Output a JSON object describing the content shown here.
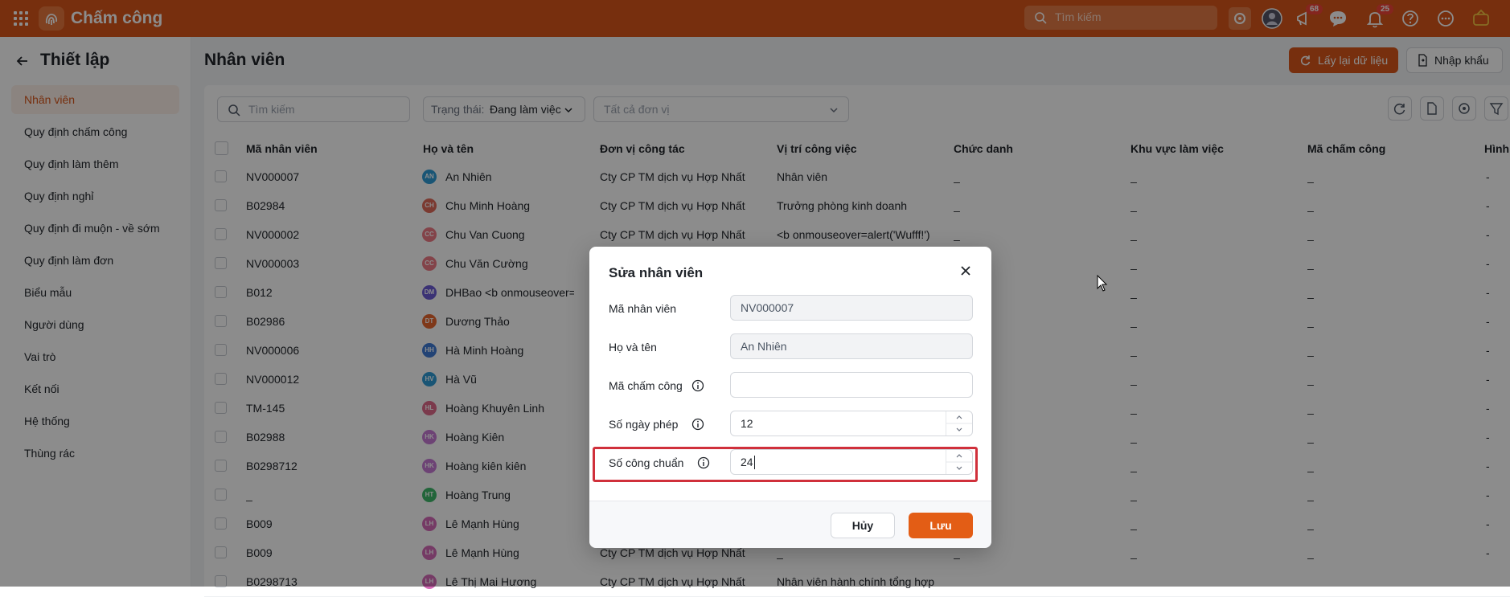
{
  "app": {
    "title": "Chấm công"
  },
  "topbar": {
    "search_placeholder": "Tìm kiếm",
    "announcement_badge": "68",
    "notification_badge": "25"
  },
  "sidebar": {
    "title": "Thiết lập",
    "items": [
      {
        "label": "Nhân viên",
        "active": true
      },
      {
        "label": "Quy định chấm công"
      },
      {
        "label": "Quy định làm thêm"
      },
      {
        "label": "Quy định nghỉ"
      },
      {
        "label": "Quy định đi muộn - về sớm"
      },
      {
        "label": "Quy định làm đơn"
      },
      {
        "label": "Biểu mẫu"
      },
      {
        "label": "Người dùng"
      },
      {
        "label": "Vai trò"
      },
      {
        "label": "Kết nối"
      },
      {
        "label": "Hệ thống"
      },
      {
        "label": "Thùng rác"
      }
    ]
  },
  "page": {
    "title": "Nhân viên",
    "reload_button": "Lấy lại dữ liệu",
    "import_button": "Nhập khẩu"
  },
  "filters": {
    "search_placeholder": "Tìm kiếm",
    "status_label": "Trạng thái:",
    "status_value": "Đang làm việc",
    "unit_placeholder": "Tất cả đơn vị"
  },
  "table": {
    "columns": [
      "Mã nhân viên",
      "Họ và tên",
      "Đơn vị công tác",
      "Vị trí công việc",
      "Chức danh",
      "Khu vực làm việc",
      "Mã chấm công",
      "Hình"
    ],
    "rows": [
      {
        "code": "NV000007",
        "initials": "AN",
        "color": "#2f9bd6",
        "name": "An Nhiên",
        "unit": "Cty CP TM dịch vụ Hợp Nhất",
        "position": "Nhân viên",
        "title": "_",
        "area": "_",
        "att": "_",
        "img": "-"
      },
      {
        "code": "B02984",
        "initials": "CH",
        "color": "#e06a5a",
        "name": "Chu Minh Hoàng",
        "unit": "Cty CP TM dịch vụ Hợp Nhất",
        "position": "Trưởng phòng kinh doanh",
        "title": "_",
        "area": "_",
        "att": "_",
        "img": "-"
      },
      {
        "code": "NV000002",
        "initials": "CC",
        "color": "#ef7b86",
        "name": "Chu Van Cuong",
        "unit": "Cty CP TM dịch vụ Hợp Nhất",
        "position": "<b onmouseover=alert('Wufff!')",
        "title": "_",
        "area": "_",
        "att": "_",
        "img": "-"
      },
      {
        "code": "NV000003",
        "initials": "CC",
        "color": "#ef7b86",
        "name": "Chu Văn Cường",
        "unit": "",
        "position": "",
        "title": "",
        "area": "_",
        "att": "_",
        "img": "-"
      },
      {
        "code": "B012",
        "initials": "DM",
        "color": "#6c5bd6",
        "name": "DHBao <b onmouseover=alert",
        "unit": "",
        "position": "",
        "title": "",
        "area": "_",
        "att": "_",
        "img": "-"
      },
      {
        "code": "B02986",
        "initials": "DT",
        "color": "#e8662f",
        "name": "Dương Thảo",
        "unit": "",
        "position": "",
        "title": "",
        "area": "_",
        "att": "_",
        "img": "-"
      },
      {
        "code": "NV000006",
        "initials": "HH",
        "color": "#3e7ad6",
        "name": "Hà Minh Hoàng",
        "unit": "",
        "position": "",
        "title": "",
        "area": "_",
        "att": "_",
        "img": "-"
      },
      {
        "code": "NV000012",
        "initials": "HV",
        "color": "#2f9bd6",
        "name": "Hà Vũ",
        "unit": "",
        "position": "",
        "title": "",
        "area": "_",
        "att": "_",
        "img": "-"
      },
      {
        "code": "TM-145",
        "initials": "HL",
        "color": "#e06a8a",
        "name": "Hoàng Khuyên Linh",
        "unit": "",
        "position": "",
        "title": "",
        "area": "_",
        "att": "_",
        "img": "-"
      },
      {
        "code": "B02988",
        "initials": "HK",
        "color": "#c77bd6",
        "name": "Hoàng Kiên",
        "unit": "",
        "position": "",
        "title": "",
        "area": "_",
        "att": "_",
        "img": "-"
      },
      {
        "code": "B0298712",
        "initials": "HK",
        "color": "#c77bd6",
        "name": "Hoàng kiên kiên",
        "unit": "",
        "position": "",
        "title": "",
        "area": "_",
        "att": "_",
        "img": "-"
      },
      {
        "code": "_",
        "initials": "HT",
        "color": "#3fb86b",
        "name": "Hoàng Trung",
        "unit": "",
        "position": "",
        "title": "",
        "area": "_",
        "att": "_",
        "img": "-"
      },
      {
        "code": "B009",
        "initials": "LH",
        "color": "#d66bb8",
        "name": "Lê Mạnh Hùng",
        "unit": "",
        "position": "",
        "title": "",
        "area": "_",
        "att": "_",
        "img": "-"
      },
      {
        "code": "B009",
        "initials": "LH",
        "color": "#d66bb8",
        "name": "Lê Mạnh Hùng",
        "unit": "Cty CP TM dịch vụ Hợp Nhất",
        "position": "_",
        "title": "_",
        "area": "_",
        "att": "_",
        "img": "-"
      },
      {
        "code": "B0298713",
        "initials": "LH",
        "color": "#d66bb8",
        "name": "Lê Thị Mai Hương",
        "unit": "Cty CP TM dịch vụ Hợp Nhất",
        "position": "Nhân viên hành chính tổng hợp",
        "title": "",
        "area": "",
        "att": "",
        "img": ""
      }
    ]
  },
  "modal": {
    "title": "Sửa nhân viên",
    "fields": [
      {
        "label": "Mã nhân viên",
        "value": "NV000007",
        "readonly": true,
        "info": false,
        "spinner": false
      },
      {
        "label": "Họ và tên",
        "value": "An Nhiên",
        "readonly": true,
        "info": false,
        "spinner": false
      },
      {
        "label": "Mã chấm công",
        "value": "",
        "readonly": false,
        "info": true,
        "spinner": false
      },
      {
        "label": "Số ngày phép",
        "value": "12",
        "readonly": false,
        "info": true,
        "spinner": true
      },
      {
        "label": "Số công chuẩn",
        "value": "24",
        "readonly": false,
        "info": true,
        "spinner": true
      }
    ],
    "cancel_button": "Hủy",
    "save_button": "Lưu"
  },
  "colors": {
    "brand": "#d9561a",
    "highlight": "#d0303b"
  }
}
